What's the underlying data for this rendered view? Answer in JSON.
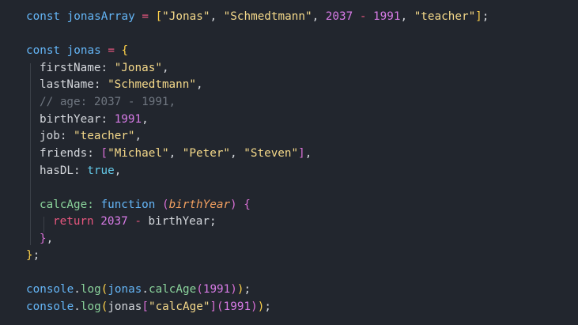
{
  "code": {
    "l1": {
      "kw": "const",
      "name": "jonasArray",
      "op": "=",
      "open": "[",
      "s1": "\"Jonas\"",
      "s2": "\"Schmedtmann\"",
      "n1": "2037",
      "minus": "-",
      "n2": "1991",
      "s3": "\"teacher\"",
      "close": "]",
      "semi": ";"
    },
    "l3": {
      "kw": "const",
      "name": "jonas",
      "op": "=",
      "open": "{"
    },
    "l4": {
      "key": "firstName:",
      "val": "\"Jonas\"",
      "comma": ","
    },
    "l5": {
      "key": "lastName:",
      "val": "\"Schmedtmann\"",
      "comma": ","
    },
    "l6": {
      "comment": "// age: 2037 - 1991,"
    },
    "l7": {
      "key": "birthYear:",
      "val": "1991",
      "comma": ","
    },
    "l8": {
      "key": "job:",
      "val": "\"teacher\"",
      "comma": ","
    },
    "l9": {
      "key": "friends:",
      "open": "[",
      "s1": "\"Michael\"",
      "s2": "\"Peter\"",
      "s3": "\"Steven\"",
      "close": "]",
      "comma": ","
    },
    "l10": {
      "key": "hasDL:",
      "val": "true",
      "comma": ","
    },
    "l12": {
      "key": "calcAge:",
      "fn": "function",
      "popen": "(",
      "param": "birthYear",
      "pclose": ")",
      "open": "{"
    },
    "l13": {
      "kw": "return",
      "n": "2037",
      "minus": "-",
      "ident": "birthYear",
      "semi": ";"
    },
    "l14": {
      "close": "}",
      "comma": ","
    },
    "l15": {
      "close": "}",
      "semi": ";"
    },
    "l17": {
      "obj": "console",
      "dot": ".",
      "method": "log",
      "p1": "(",
      "ident": "jonas",
      "dot2": ".",
      "method2": "calcAge",
      "p2": "(",
      "n": "1991",
      "p3": ")",
      "p4": ")",
      "semi": ";"
    },
    "l18": {
      "obj": "console",
      "dot": ".",
      "method": "log",
      "p1": "(",
      "ident": "jonas",
      "b1": "[",
      "s": "\"calcAge\"",
      "b2": "]",
      "p2": "(",
      "n": "1991",
      "p3": ")",
      "p4": ")",
      "semi": ";"
    }
  },
  "colors": {
    "background": "#22262e",
    "keyword": "#64b5f6",
    "string": "#f5d98a",
    "number": "#d77be6",
    "operator": "#e8577f",
    "comment": "#6f7680",
    "function": "#8bd49c",
    "parameter": "#f2a060"
  }
}
